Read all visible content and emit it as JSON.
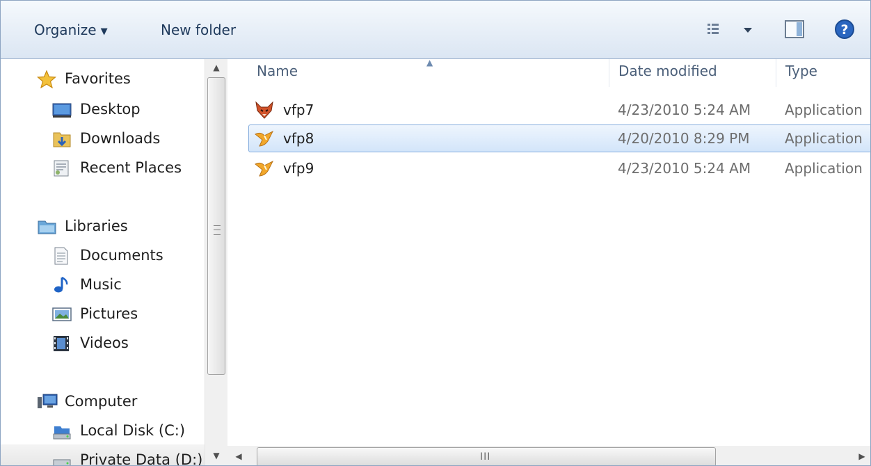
{
  "toolbar": {
    "organize_label": "Organize",
    "new_folder_label": "New folder"
  },
  "nav": {
    "favorites": {
      "label": "Favorites",
      "items": [
        "Desktop",
        "Downloads",
        "Recent Places"
      ]
    },
    "libraries": {
      "label": "Libraries",
      "items": [
        "Documents",
        "Music",
        "Pictures",
        "Videos"
      ]
    },
    "computer": {
      "label": "Computer",
      "items": [
        "Local Disk (C:)",
        "Private Data (D:)"
      ]
    }
  },
  "columns": {
    "name": "Name",
    "date": "Date modified",
    "type": "Type"
  },
  "files": [
    {
      "name": "vfp7",
      "date": "4/23/2010 5:24 AM",
      "type": "Application"
    },
    {
      "name": "vfp8",
      "date": "4/20/2010 8:29 PM",
      "type": "Application"
    },
    {
      "name": "vfp9",
      "date": "4/23/2010 5:24 AM",
      "type": "Application"
    }
  ],
  "selected_file": "vfp8",
  "icons": {
    "views": "view-options-icon",
    "preview": "preview-pane-icon",
    "help": "help-icon"
  }
}
